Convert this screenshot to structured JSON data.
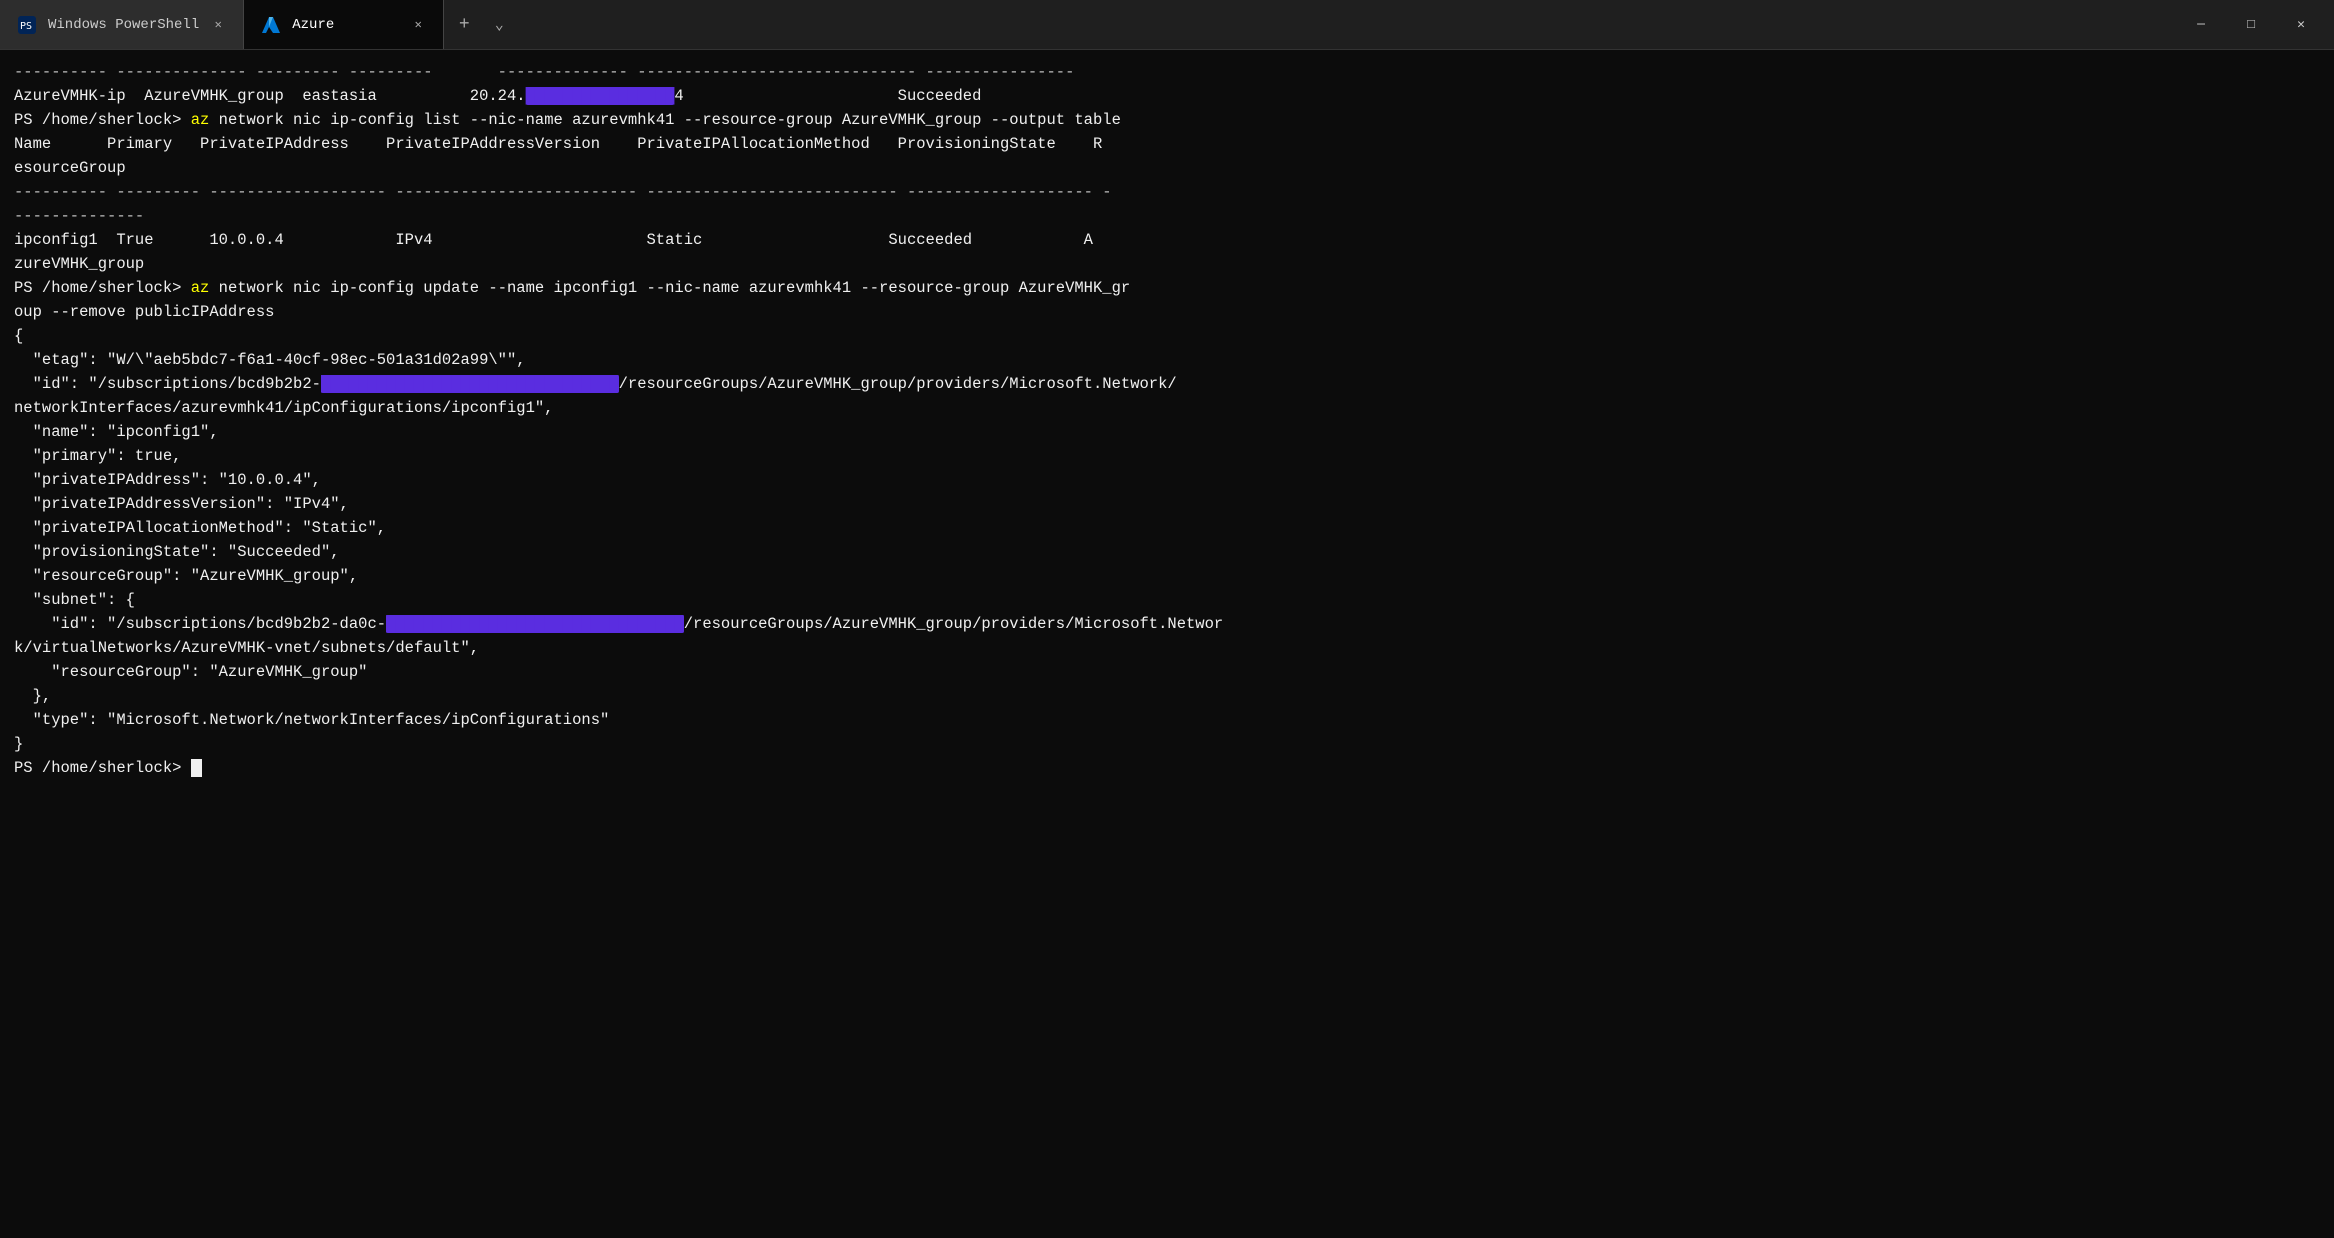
{
  "window": {
    "title": "Azure",
    "tabs": [
      {
        "id": "powershell",
        "label": "Windows PowerShell",
        "active": false
      },
      {
        "id": "azure",
        "label": "Azure",
        "active": true
      }
    ],
    "controls": {
      "minimize": "─",
      "maximize": "□",
      "close": "✕"
    }
  },
  "terminal": {
    "bg": "#0c0c0c",
    "lines": [
      {
        "type": "separator",
        "text": "---------- -------------- --------- --------- -------------- ------------------------------ ----------------"
      },
      {
        "type": "data",
        "text": "AzureVMHK-ip  AzureVMHK_group  eastasia         20.24.",
        "redacted": "███████████████",
        "after": "4                               Succeeded"
      },
      {
        "type": "prompt_cmd",
        "prompt": "PS /home/sherlock> ",
        "az": "az",
        "rest": " network nic ip-config list --nic-name azurevmhk41 --resource-group AzureVMHK_group --output table"
      },
      {
        "type": "data",
        "text": "Name       Primary   PrivateIPAddress    PrivateIPAddressVersion    PrivateIPAllocationMethod   ProvisioningState    R"
      },
      {
        "type": "data",
        "text": "esourceGroup"
      },
      {
        "type": "separator",
        "text": "---------- --------- ------------------- -------------------------- --------------------------- -------------------- -"
      },
      {
        "type": "separator",
        "text": "--------------"
      },
      {
        "type": "data",
        "text": "ipconfig1  True      10.0.0.4            IPv4                       Static                      Succeeded            A"
      },
      {
        "type": "data",
        "text": "zureVMHK_group"
      },
      {
        "type": "prompt_cmd",
        "prompt": "PS /home/sherlock> ",
        "az": "az",
        "rest": " network nic ip-config update --name ipconfig1 --nic-name azurevmhk41 --resource-group AzureVMHK_gr"
      },
      {
        "type": "data",
        "text": "oup --remove publicIPAddress"
      },
      {
        "type": "data",
        "text": "{"
      },
      {
        "type": "data",
        "text": "  \"etag\": \"W/\\\"aeb5bdc7-f6a1-40cf-98ec-501a31d02a99\\\"\","
      },
      {
        "type": "data_redact_id",
        "prefix": "  \"id\": \"/subscriptions/bcd9b2b2-",
        "redacted": "████████████████████████████████",
        "suffix": "/resourceGroups/AzureVMHK_group/providers/Microsoft.Network/"
      },
      {
        "type": "data",
        "text": "networkInterfaces/azurevmhk41/ipConfigurations/ipconfig1\","
      },
      {
        "type": "data",
        "text": "  \"name\": \"ipconfig1\","
      },
      {
        "type": "data",
        "text": "  \"primary\": true,"
      },
      {
        "type": "data",
        "text": "  \"privateIPAddress\": \"10.0.0.4\","
      },
      {
        "type": "data",
        "text": "  \"privateIPAddressVersion\": \"IPv4\","
      },
      {
        "type": "data",
        "text": "  \"privateIPAllocationMethod\": \"Static\","
      },
      {
        "type": "data",
        "text": "  \"provisioningState\": \"Succeeded\","
      },
      {
        "type": "data",
        "text": "  \"resourceGroup\": \"AzureVMHK_group\","
      },
      {
        "type": "data",
        "text": "  \"subnet\": {"
      },
      {
        "type": "data_redact_subnet",
        "prefix": "    \"id\": \"/subscriptions/bcd9b2b2-da0c-",
        "redacted": "████████████████████████████████",
        "suffix": "/resourceGroups/AzureVMHK_group/providers/Microsoft.Networ"
      },
      {
        "type": "data",
        "text": "k/virtualNetworks/AzureVMHK-vnet/subnets/default\","
      },
      {
        "type": "data",
        "text": "    \"resourceGroup\": \"AzureVMHK_group\""
      },
      {
        "type": "data",
        "text": "  },"
      },
      {
        "type": "data",
        "text": "  \"type\": \"Microsoft.Network/networkInterfaces/ipConfigurations\""
      },
      {
        "type": "data",
        "text": "}"
      },
      {
        "type": "prompt_cursor",
        "prompt": "PS /home/sherlock> "
      }
    ]
  }
}
